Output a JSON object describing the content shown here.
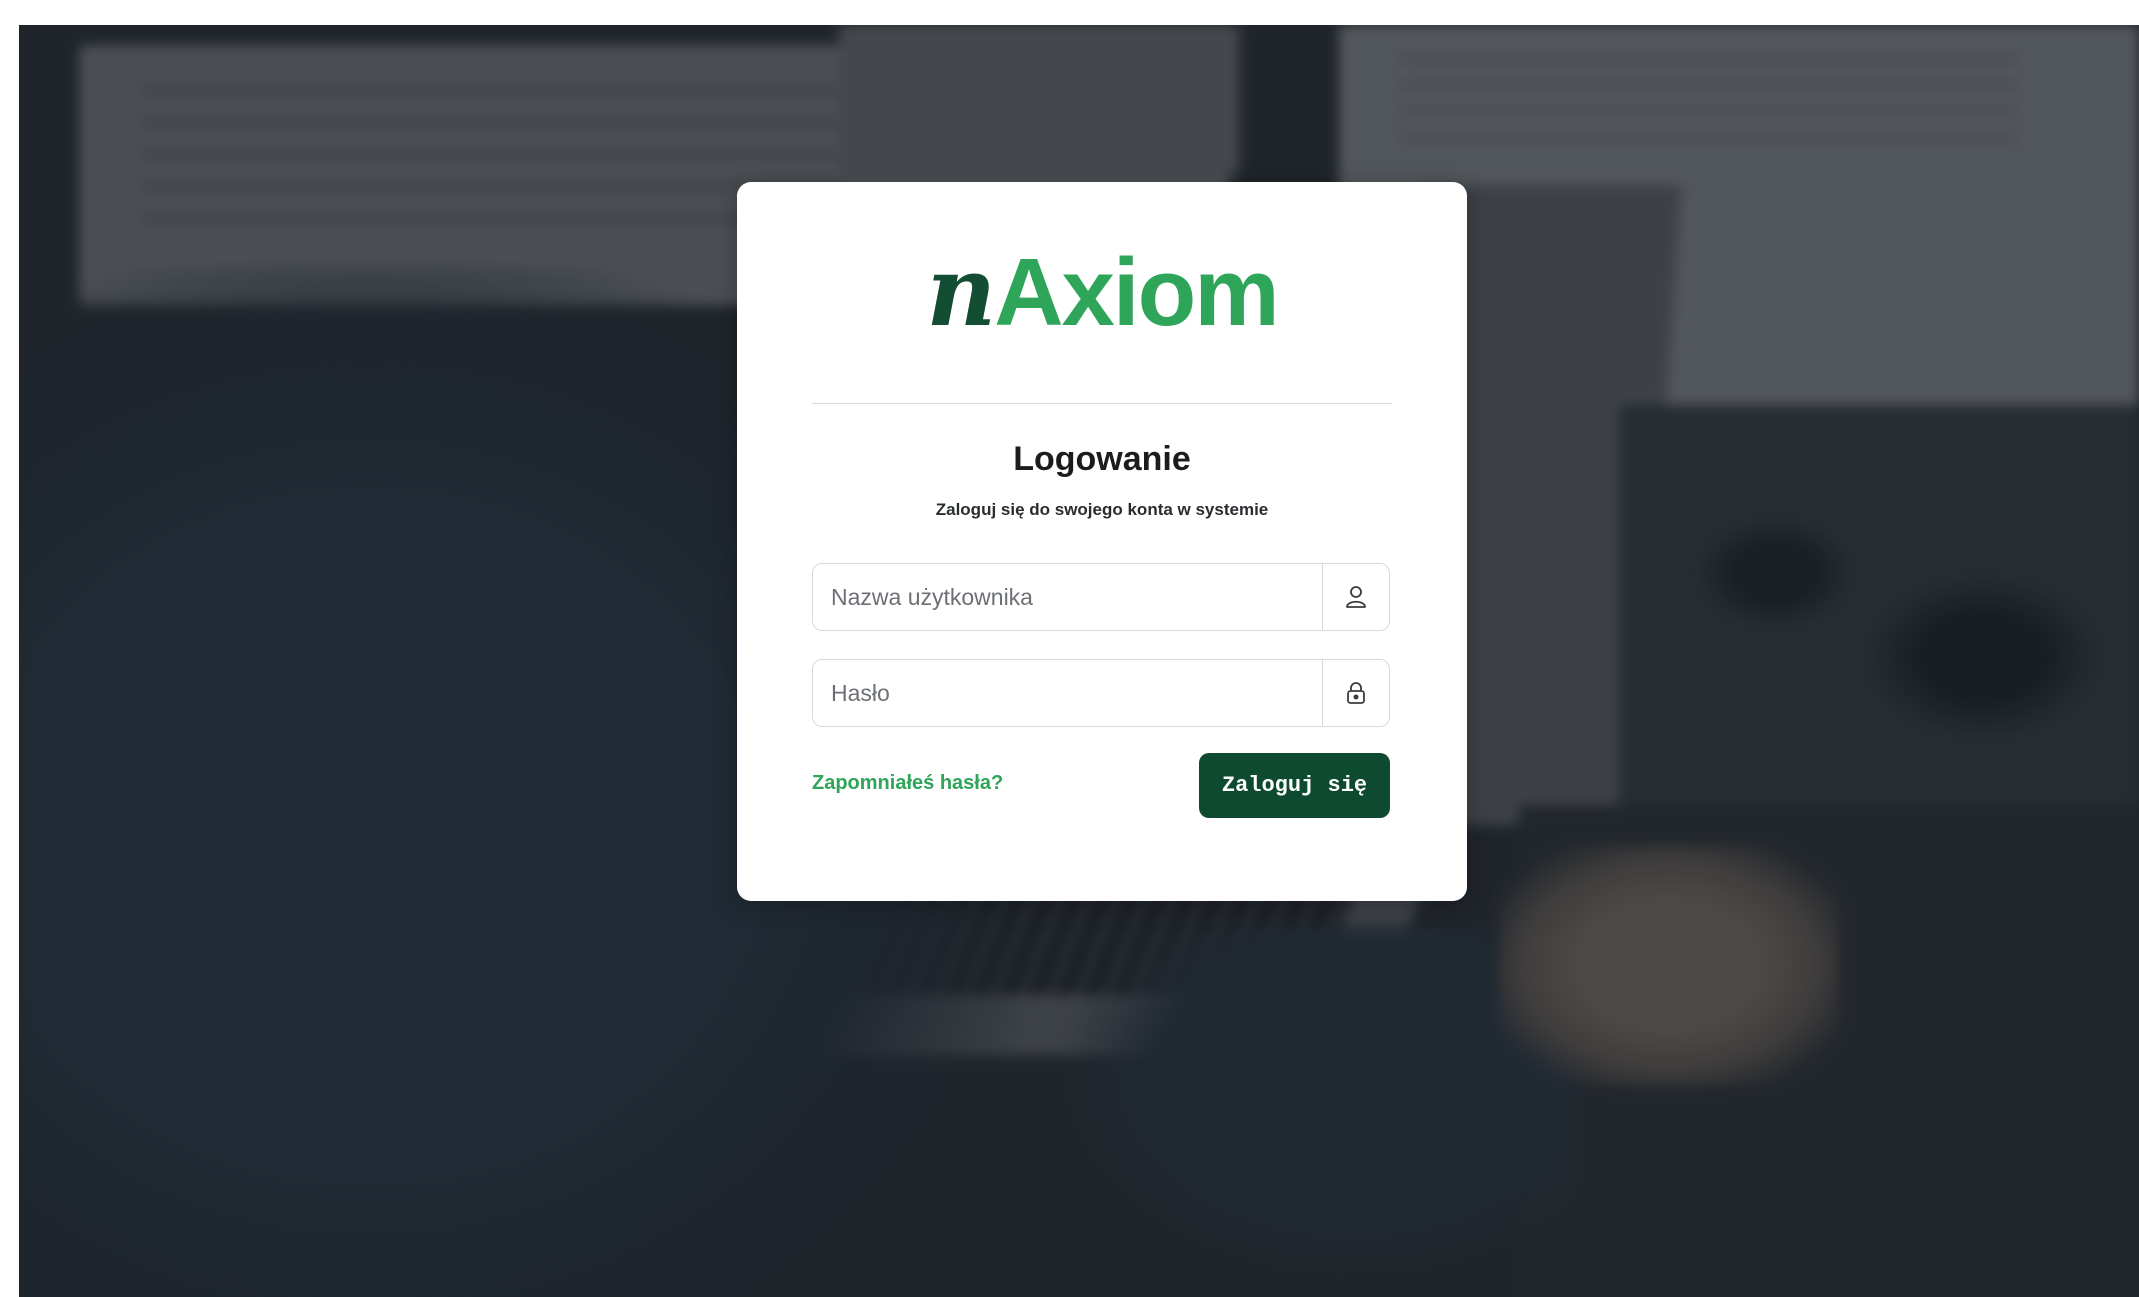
{
  "logo": {
    "prefix": "n",
    "name": "Axiom"
  },
  "login": {
    "title": "Logowanie",
    "subtitle": "Zaloguj się do swojego konta w systemie",
    "username_placeholder": "Nazwa użytkownika",
    "username_value": "",
    "password_placeholder": "Hasło",
    "password_value": "",
    "forgot_link": "Zapomniałeś hasła?",
    "submit_label": "Zaloguj się"
  },
  "icons": {
    "username": "user-icon",
    "password": "lock-icon"
  },
  "colors": {
    "brand_dark": "#124d34",
    "brand_green": "#2fa55a",
    "button_bg": "#0e4a30"
  }
}
